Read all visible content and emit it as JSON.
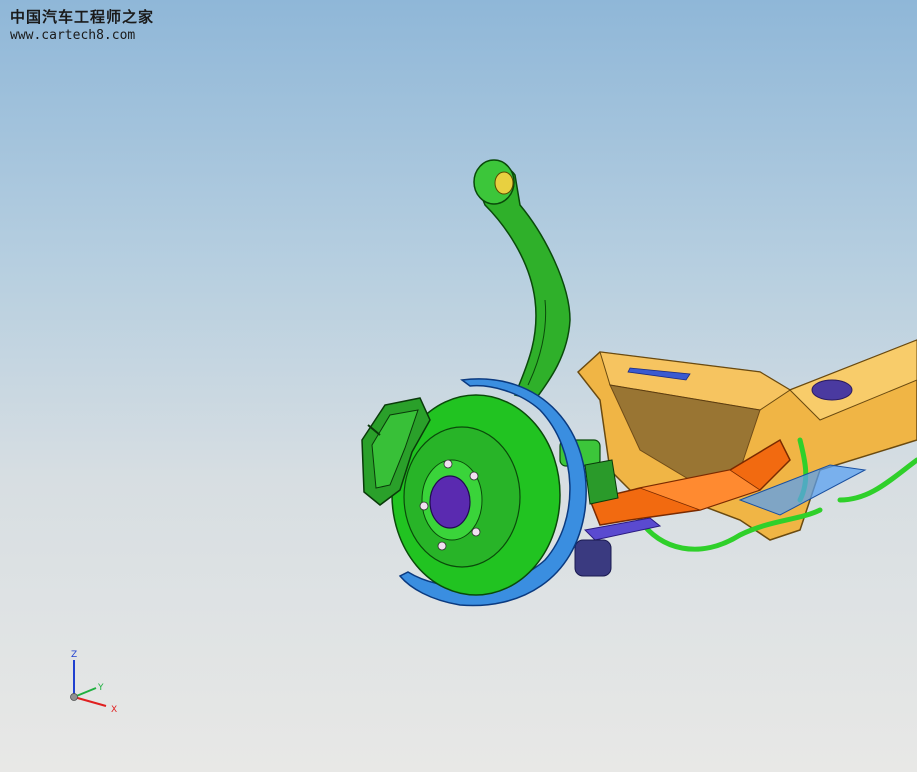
{
  "watermark": {
    "title": "中国汽车工程师之家",
    "url": "www.cartech8.com"
  },
  "triad": {
    "z_label": "Z",
    "y_label": "Y",
    "x_label": "X"
  },
  "colors": {
    "background_top": "#8fb7d8",
    "background_bottom": "#e8e8e6",
    "knuckle_green": "#2fb02a",
    "brake_disc_green": "#21c321",
    "dust_shield_blue": "#3a8ee0",
    "subframe_yellow": "#f0b545",
    "control_arm_orange": "#f26a10",
    "axis_z": "#2040d0",
    "axis_y": "#20b040",
    "axis_x": "#e02020"
  }
}
